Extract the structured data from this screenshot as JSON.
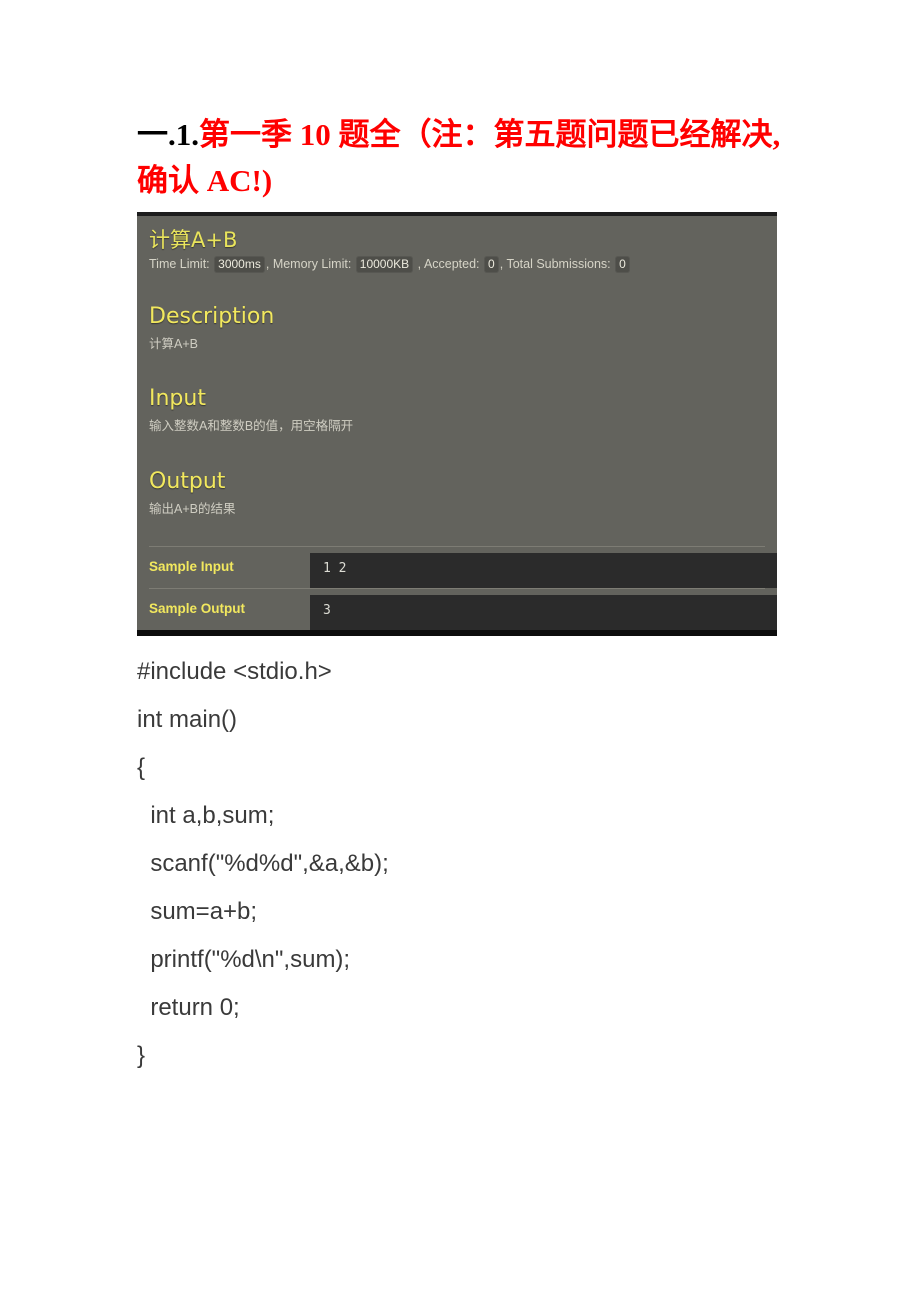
{
  "document": {
    "heading_number": "一.1.",
    "heading_text": "第一季 10 题全（注：第五题问题已经解决,确认 AC!)",
    "heading_color": "#ff0000"
  },
  "oj_panel": {
    "problem_title": "计算A+B",
    "meta": {
      "time_limit_label": "Time Limit:",
      "time_limit_value": "3000ms",
      "memory_limit_label": "Memory Limit:",
      "memory_limit_value": "10000KB",
      "accepted_label": "Accepted:",
      "accepted_value": "0",
      "total_submissions_label": "Total Submissions:",
      "total_submissions_value": "0",
      "comma": ","
    },
    "sections": [
      {
        "heading": "Description",
        "body": "计算A+B"
      },
      {
        "heading": "Input",
        "body": "输入整数A和整数B的值，用空格隔开"
      },
      {
        "heading": "Output",
        "body": "输出A+B的结果"
      }
    ],
    "samples": [
      {
        "label": "Sample Input",
        "value": "1 2"
      },
      {
        "label": "Sample Output",
        "value": "3"
      }
    ],
    "colors": {
      "panel_background": "#63635d",
      "heading_yellow": "#f2e85e",
      "body_text": "#cfcdc2",
      "sample_box_background": "#2b2b2b"
    }
  },
  "code": {
    "language": "c",
    "lines": [
      "#include <stdio.h>",
      "int main()",
      "{",
      "  int a,b,sum;",
      "  scanf(\"%d%d\",&a,&b);",
      "  sum=a+b;",
      "  printf(\"%d\\n\",sum);",
      "  return 0;",
      "}"
    ]
  }
}
